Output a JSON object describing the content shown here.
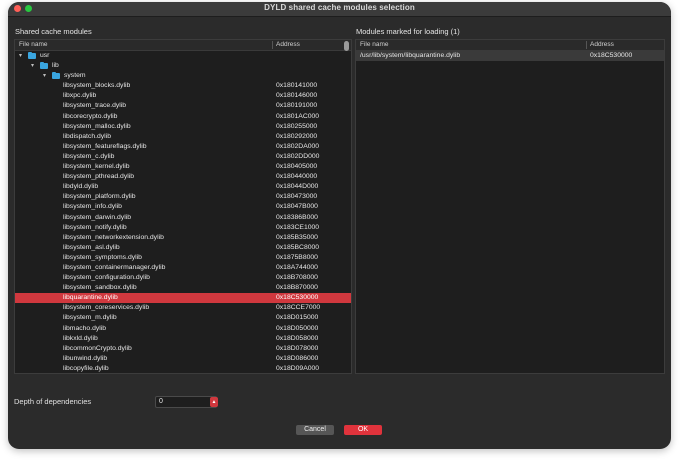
{
  "window": {
    "title": "DYLD shared cache modules selection"
  },
  "left_panel": {
    "header": "Shared cache modules",
    "columns": [
      "File name",
      "Address"
    ],
    "tree": [
      {
        "name": "usr",
        "level": 0,
        "folder": true,
        "expanded": true
      },
      {
        "name": "lib",
        "level": 1,
        "folder": true,
        "expanded": true
      },
      {
        "name": "system",
        "level": 2,
        "folder": true,
        "expanded": true
      }
    ],
    "rows": [
      {
        "name": "libsystem_blocks.dylib",
        "address": "0x180141000"
      },
      {
        "name": "libxpc.dylib",
        "address": "0x180146000"
      },
      {
        "name": "libsystem_trace.dylib",
        "address": "0x180191000"
      },
      {
        "name": "libcorecrypto.dylib",
        "address": "0x1801AC000"
      },
      {
        "name": "libsystem_malloc.dylib",
        "address": "0x180255000"
      },
      {
        "name": "libdispatch.dylib",
        "address": "0x180292000"
      },
      {
        "name": "libsystem_featureflags.dylib",
        "address": "0x1802DA000"
      },
      {
        "name": "libsystem_c.dylib",
        "address": "0x1802DD000"
      },
      {
        "name": "libsystem_kernel.dylib",
        "address": "0x180405000"
      },
      {
        "name": "libsystem_pthread.dylib",
        "address": "0x180440000"
      },
      {
        "name": "libdyld.dylib",
        "address": "0x18044D000"
      },
      {
        "name": "libsystem_platform.dylib",
        "address": "0x180473000"
      },
      {
        "name": "libsystem_info.dylib",
        "address": "0x18047B000"
      },
      {
        "name": "libsystem_darwin.dylib",
        "address": "0x18386B000"
      },
      {
        "name": "libsystem_notify.dylib",
        "address": "0x183CE1000"
      },
      {
        "name": "libsystem_networkextension.dylib",
        "address": "0x185B35000"
      },
      {
        "name": "libsystem_asl.dylib",
        "address": "0x185BC8000"
      },
      {
        "name": "libsystem_symptoms.dylib",
        "address": "0x1875B8000"
      },
      {
        "name": "libsystem_containermanager.dylib",
        "address": "0x18A744000"
      },
      {
        "name": "libsystem_configuration.dylib",
        "address": "0x18B708000"
      },
      {
        "name": "libsystem_sandbox.dylib",
        "address": "0x18B870000"
      },
      {
        "name": "libquarantine.dylib",
        "address": "0x18C530000",
        "selected": true
      },
      {
        "name": "libsystem_coreservices.dylib",
        "address": "0x18CCE7000"
      },
      {
        "name": "libsystem_m.dylib",
        "address": "0x18D015000"
      },
      {
        "name": "libmacho.dylib",
        "address": "0x18D050000"
      },
      {
        "name": "libkxld.dylib",
        "address": "0x18D058000"
      },
      {
        "name": "libcommonCrypto.dylib",
        "address": "0x18D078000"
      },
      {
        "name": "libunwind.dylib",
        "address": "0x18D086000"
      },
      {
        "name": "libcopyfile.dylib",
        "address": "0x18D09A000"
      }
    ]
  },
  "right_panel": {
    "header": "Modules marked for loading (1)",
    "columns": [
      "File name",
      "Address"
    ],
    "rows": [
      {
        "name": "/usr/lib/system/libquarantine.dylib",
        "address": "0x18C530000"
      }
    ]
  },
  "depth": {
    "label": "Depth of dependencies",
    "value": "0"
  },
  "buttons": {
    "cancel": "Cancel",
    "ok": "OK"
  },
  "colors": {
    "accent": "#d0383e",
    "folder": "#3aa6e0",
    "background": "#2b2b2b"
  }
}
